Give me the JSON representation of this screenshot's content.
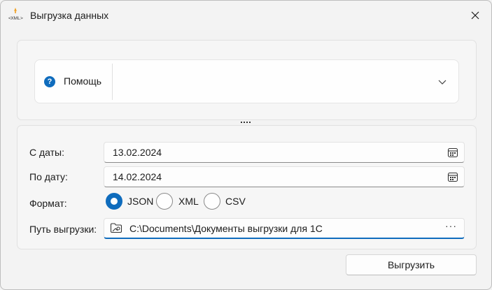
{
  "window": {
    "title": "Выгрузка данных",
    "app_icon_text": "XML"
  },
  "help": {
    "icon_char": "?",
    "label": "Помощь"
  },
  "form": {
    "date_from": {
      "label": "С даты:",
      "value": "13.02.2024"
    },
    "date_to": {
      "label": "По дату:",
      "value": "14.02.2024"
    },
    "format": {
      "label": "Формат:",
      "options": [
        "JSON",
        "XML",
        "CSV"
      ],
      "selected": "JSON"
    },
    "path": {
      "label": "Путь выгрузки:",
      "value": "C:\\Documents\\Документы выгрузки для 1С",
      "browse_label": "···"
    }
  },
  "actions": {
    "export_label": "Выгрузить"
  },
  "colors": {
    "accent": "#0f6cbd",
    "background": "#f3f3f3",
    "panel": "#f6f6f6"
  },
  "icons": [
    "xml-app-icon",
    "close-icon",
    "help-icon",
    "chevron-down-icon",
    "calendar-icon",
    "folder-icon",
    "more-icon"
  ]
}
